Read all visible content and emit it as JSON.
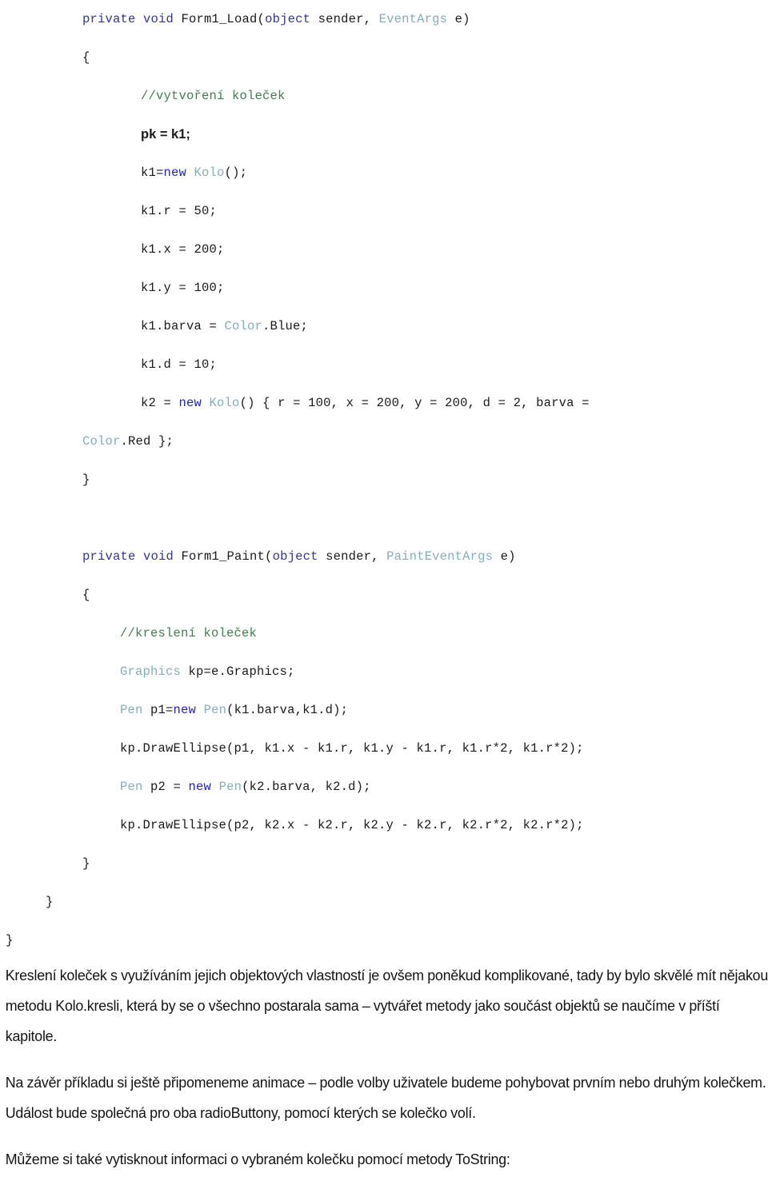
{
  "document": {
    "language": "cs",
    "code_listing": [
      {
        "id": "line-1",
        "indent": "ind2",
        "font": "mono",
        "tokens": [
          {
            "text": "private void ",
            "style": "kw"
          },
          {
            "text": "Form1_Load(",
            "style": "plain"
          },
          {
            "text": "object",
            "style": "kw"
          },
          {
            "text": " sender, ",
            "style": "plain"
          },
          {
            "text": "EventArgs",
            "style": "type"
          },
          {
            "text": " e)",
            "style": "plain"
          }
        ]
      },
      {
        "id": "line-2",
        "indent": "ind2",
        "font": "mono",
        "tokens": [
          {
            "text": "{",
            "style": "plain"
          }
        ]
      },
      {
        "id": "line-3",
        "indent": "ind4",
        "font": "mono",
        "tokens": [
          {
            "text": "//vytvoření koleček",
            "style": "cmt"
          }
        ]
      },
      {
        "id": "line-4",
        "indent": "ind4",
        "font": "sans",
        "tokens": [
          {
            "text": "pk = k1;",
            "style": "plain"
          }
        ]
      },
      {
        "id": "line-5",
        "indent": "ind4",
        "font": "mono",
        "tokens": [
          {
            "text": "k1=",
            "style": "plain"
          },
          {
            "text": "new",
            "style": "kw-new"
          },
          {
            "text": " ",
            "style": "plain"
          },
          {
            "text": "Kolo",
            "style": "type"
          },
          {
            "text": "();",
            "style": "plain"
          }
        ]
      },
      {
        "id": "line-6",
        "indent": "ind4",
        "font": "mono",
        "tokens": [
          {
            "text": "k1.r = 50;",
            "style": "plain"
          }
        ]
      },
      {
        "id": "line-7",
        "indent": "ind4",
        "font": "mono",
        "tokens": [
          {
            "text": "k1.x = 200;",
            "style": "plain"
          }
        ]
      },
      {
        "id": "line-8",
        "indent": "ind4",
        "font": "mono",
        "tokens": [
          {
            "text": "k1.y = 100;",
            "style": "plain"
          }
        ]
      },
      {
        "id": "line-9",
        "indent": "ind4",
        "font": "mono",
        "tokens": [
          {
            "text": "k1.barva = ",
            "style": "plain"
          },
          {
            "text": "Color",
            "style": "type"
          },
          {
            "text": ".Blue;",
            "style": "plain"
          }
        ]
      },
      {
        "id": "line-10",
        "indent": "ind4",
        "font": "mono",
        "tokens": [
          {
            "text": "k1.d = 10;",
            "style": "plain"
          }
        ]
      },
      {
        "id": "line-11",
        "indent": "ind4",
        "font": "mono",
        "tokens": [
          {
            "text": "k2 = ",
            "style": "plain"
          },
          {
            "text": "new",
            "style": "kw-new"
          },
          {
            "text": " ",
            "style": "plain"
          },
          {
            "text": "Kolo",
            "style": "type"
          },
          {
            "text": "() { r = 100, x = 200, y = 200, d = 2, barva =",
            "style": "plain"
          }
        ]
      },
      {
        "id": "line-12",
        "indent": "ind2",
        "font": "mono",
        "tokens": [
          {
            "text": "Color",
            "style": "type"
          },
          {
            "text": ".Red };",
            "style": "plain"
          }
        ]
      },
      {
        "id": "line-13",
        "indent": "ind2",
        "font": "mono",
        "tokens": [
          {
            "text": "}",
            "style": "plain"
          }
        ]
      },
      {
        "id": "line-14",
        "indent": "ind2",
        "font": "mono",
        "tokens": [
          {
            "text": " ",
            "style": "plain"
          }
        ]
      },
      {
        "id": "line-15",
        "indent": "ind2",
        "font": "mono",
        "tokens": [
          {
            "text": "private void ",
            "style": "kw"
          },
          {
            "text": "Form1_Paint(",
            "style": "plain"
          },
          {
            "text": "object",
            "style": "kw"
          },
          {
            "text": " sender, ",
            "style": "plain"
          },
          {
            "text": "PaintEventArgs",
            "style": "type"
          },
          {
            "text": " e)",
            "style": "plain"
          }
        ]
      },
      {
        "id": "line-16",
        "indent": "ind2",
        "font": "mono",
        "tokens": [
          {
            "text": "{",
            "style": "plain"
          }
        ]
      },
      {
        "id": "line-17",
        "indent": "ind3",
        "font": "mono",
        "tokens": [
          {
            "text": "//kreslení koleček",
            "style": "cmt"
          }
        ]
      },
      {
        "id": "line-18",
        "indent": "ind3",
        "font": "mono",
        "tokens": [
          {
            "text": "Graphics",
            "style": "type"
          },
          {
            "text": " kp=e.Graphics;",
            "style": "plain"
          }
        ]
      },
      {
        "id": "line-19",
        "indent": "ind3",
        "font": "mono",
        "tokens": [
          {
            "text": "Pen",
            "style": "type"
          },
          {
            "text": " p1=",
            "style": "plain"
          },
          {
            "text": "new",
            "style": "kw-new"
          },
          {
            "text": " ",
            "style": "plain"
          },
          {
            "text": "Pen",
            "style": "type"
          },
          {
            "text": "(k1.barva,k1.d);",
            "style": "plain"
          }
        ]
      },
      {
        "id": "line-20",
        "indent": "ind3",
        "font": "mono",
        "tokens": [
          {
            "text": "kp.DrawEllipse(p1, k1.x - k1.r, k1.y - k1.r, k1.r*2, k1.r*2);",
            "style": "plain"
          }
        ]
      },
      {
        "id": "line-21",
        "indent": "ind3",
        "font": "mono",
        "tokens": [
          {
            "text": "Pen",
            "style": "type"
          },
          {
            "text": " p2 = ",
            "style": "plain"
          },
          {
            "text": "new",
            "style": "kw-new"
          },
          {
            "text": " ",
            "style": "plain"
          },
          {
            "text": "Pen",
            "style": "type"
          },
          {
            "text": "(k2.barva, k2.d);",
            "style": "plain"
          }
        ]
      },
      {
        "id": "line-22",
        "indent": "ind3",
        "font": "mono",
        "tokens": [
          {
            "text": "kp.DrawEllipse(p2, k2.x - k2.r, k2.y - k2.r, k2.r*2, k2.r*2);",
            "style": "plain"
          }
        ]
      },
      {
        "id": "line-23",
        "indent": "ind2",
        "font": "mono",
        "tokens": [
          {
            "text": "}",
            "style": "plain"
          }
        ]
      },
      {
        "id": "line-24",
        "indent": "ind1",
        "font": "mono",
        "tokens": [
          {
            "text": "}",
            "style": "plain"
          }
        ]
      },
      {
        "id": "line-25",
        "indent": "ind0",
        "font": "mono",
        "tokens": [
          {
            "text": "}",
            "style": "plain"
          }
        ]
      }
    ],
    "paragraphs": [
      {
        "id": "paragraph-1",
        "text": "Kreslení koleček s využíváním jejich objektových vlastností je ovšem poněkud komplikované, tady by bylo skvělé mít nějakou metodu Kolo.kresli, která by se o všechno postarala sama – vytvářet metody jako součást objektů se naučíme v příští kapitole."
      },
      {
        "id": "paragraph-2",
        "text": "Na závěr příkladu si ještě připomeneme animace – podle volby uživatele budeme pohybovat prvním nebo druhým kolečkem. Událost bude společná pro oba radioButtony, pomocí kterých se kolečko volí."
      },
      {
        "id": "paragraph-3",
        "text": "Můžeme si také vytisknout informaci o vybraném kolečku pomocí metody ToString:"
      }
    ],
    "colors": {
      "keyword": "#33339b",
      "keyword_new": "#2222cc",
      "type": "#82aebb",
      "comment": "#3f7d50",
      "text": "#1a1a1a",
      "background": "#ffffff"
    }
  }
}
